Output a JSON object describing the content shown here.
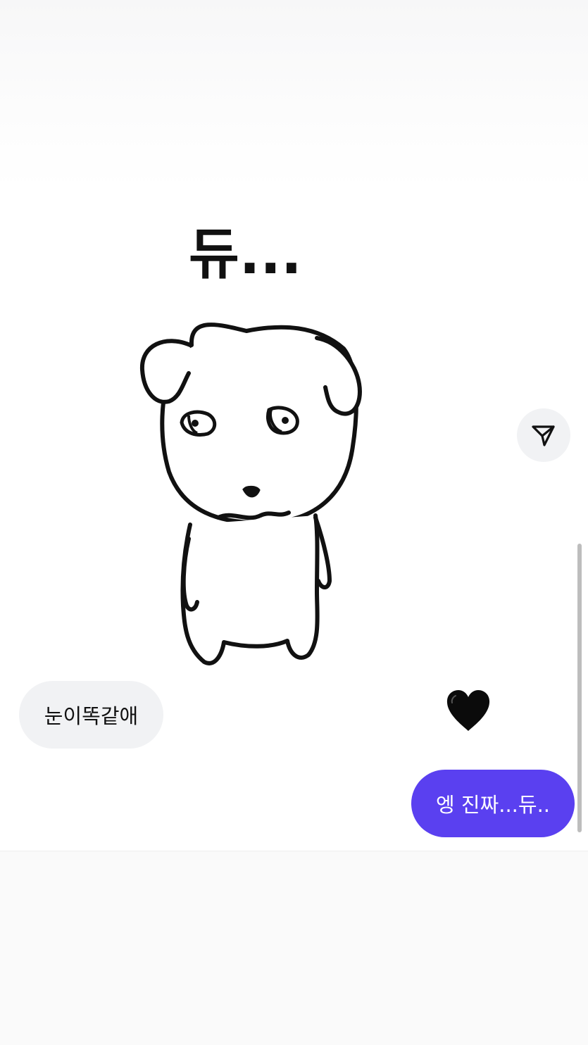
{
  "sticker": {
    "text": "듀...",
    "icon": "puppy-drawing"
  },
  "share_button": {
    "icon": "send-arrow-icon"
  },
  "messages": {
    "received": {
      "text": "눈이똑같애"
    },
    "reaction": {
      "emoji": "🖤"
    },
    "sent": {
      "text": "엥 진짜...듀.."
    }
  },
  "colors": {
    "sent_bubble": "#5a40f0",
    "received_bubble": "#f1f2f4",
    "share_button_bg": "#f1f2f4"
  }
}
